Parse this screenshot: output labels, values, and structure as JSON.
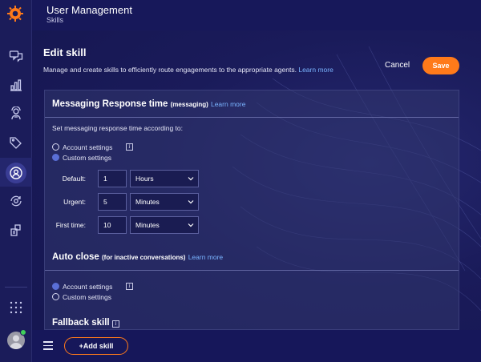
{
  "header": {
    "title": "User Management",
    "subtitle": "Skills"
  },
  "page": {
    "title": "Edit skill",
    "description": "Manage and create skills to efficiently route engagements to the appropriate agents.",
    "learn_more": "Learn more",
    "cancel_label": "Cancel",
    "save_label": "Save"
  },
  "messaging": {
    "title": "Messaging Response time",
    "paren": "(messaging)",
    "learn_more": "Learn more",
    "instruction": "Set messaging response time according to:",
    "options": [
      "Account settings",
      "Custom settings"
    ],
    "selected": "Custom settings",
    "rows": [
      {
        "label": "Default:",
        "value": "1",
        "unit": "Hours"
      },
      {
        "label": "Urgent:",
        "value": "5",
        "unit": "Minutes"
      },
      {
        "label": "First time:",
        "value": "10",
        "unit": "Minutes"
      }
    ]
  },
  "auto_close": {
    "title": "Auto close",
    "paren": "(for inactive conversations)",
    "learn_more": "Learn more",
    "options": [
      "Account settings",
      "Custom settings"
    ],
    "selected": "Account settings"
  },
  "fallback": {
    "title": "Fallback skill"
  },
  "bottom": {
    "add_skill_label": "+Add skill"
  },
  "sidebar": {
    "items": [
      "chat-icon",
      "bar-chart-icon",
      "agent-icon",
      "tag-icon",
      "user-management-icon",
      "automation-icon",
      "integrations-icon",
      "apps-grid-icon"
    ],
    "active": "user-management-icon"
  },
  "colors": {
    "accent": "#ff7a1a",
    "link": "#7ab4ff",
    "background": "#15164a",
    "status_online": "#3fcf5a"
  }
}
